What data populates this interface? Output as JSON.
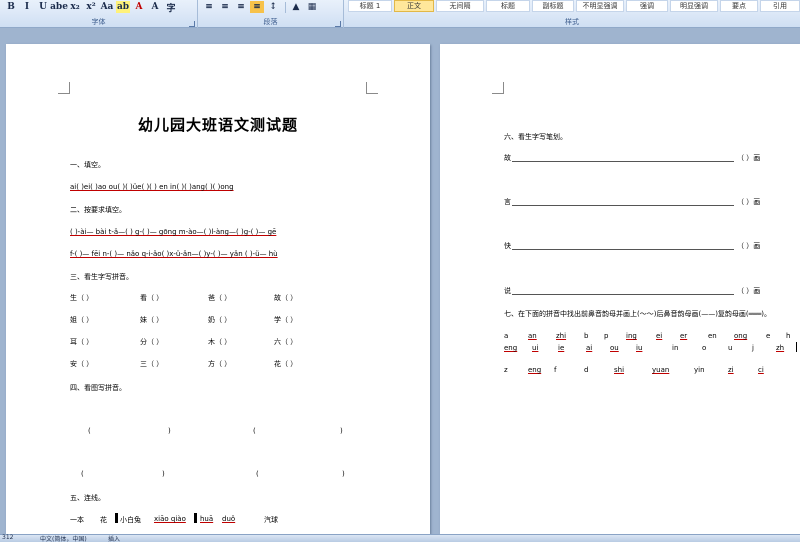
{
  "ribbon": {
    "font_group_label": "字体",
    "paragraph_group_label": "段落",
    "styles_group_label": "样式",
    "font_buttons": [
      "B",
      "I",
      "U",
      "abe",
      "x₂",
      "x²",
      "Aa",
      "ab",
      "A",
      "A",
      "字"
    ],
    "styles": [
      "标题 1",
      "正文",
      "无间隔",
      "标题",
      "副标题",
      "不明显强调",
      "强调",
      "明显强调",
      "要点",
      "引用",
      "明显"
    ]
  },
  "page1": {
    "title": "幼儿园大班语文测试题",
    "q1": "一、填空。",
    "q1_line": "ai(   )ei(   )ao ou(   )(   )üe(   )(   ) en in(   )(   )ang(   )(   )ong",
    "q2": "二、按要求填空。",
    "q2_line1": "(   )-ài— bài  t-ǎ—(   )  g-(   )— gōng  m-ào—(   )l-àng—(   )g-(   )— gē",
    "q2_line2": "f-(   )— fēi  n-(   )— nǎo  q-i-ǎo(   )x-ü-ǎn—(   )y-(   )— yǎn  (   )-ü— hù",
    "q3": "三、看生字写拼音。",
    "q3_grid": [
      [
        "生（        ）",
        "看（        ）",
        "爸（        ）",
        "故（        ）"
      ],
      [
        "姐（        ）",
        "妹（        ）",
        "奶（        ）",
        "学（        ）"
      ],
      [
        "耳（        ）",
        "分（        ）",
        "木（        ）",
        "六（        ）"
      ],
      [
        "安（        ）",
        "三（        ）",
        "方（        ）",
        "花（        ）"
      ]
    ],
    "q4": "四、看图写拼音。",
    "q4_parens": [
      "(",
      ")",
      "(",
      ")",
      "(",
      ")",
      "(",
      ")"
    ],
    "q5": "五、连线。",
    "q5_items": [
      "一本",
      "花",
      "小白兔",
      "xiāo qiào",
      "huā",
      "duǒ",
      "汽球"
    ]
  },
  "page2": {
    "q6": "六、看生字写笔划。",
    "q6_chars": [
      "故",
      "言",
      "快",
      "说"
    ],
    "q6_suffix": "（    ）画",
    "q7": "七、在下面的拼音中找出前鼻音韵母并画上(～～)后鼻音韵母画(——)复韵母画(═══)。",
    "q7_row1": [
      "a",
      "an",
      "zhi",
      "b",
      "p",
      "ing",
      "ei",
      "er",
      "en",
      "ong",
      "e",
      "h"
    ],
    "q7_row2": [
      "eng",
      "ui",
      "ie",
      "ai",
      "ou",
      "iu",
      "in",
      "o",
      "u",
      "j",
      "zh"
    ],
    "q7_row3": [
      "z",
      "eng",
      "f",
      "d",
      "shi",
      "yuan",
      "yin",
      "zi",
      "ci"
    ]
  },
  "status": {
    "page": "312",
    "language": "中文(简体，中国)",
    "mode": "插入"
  }
}
